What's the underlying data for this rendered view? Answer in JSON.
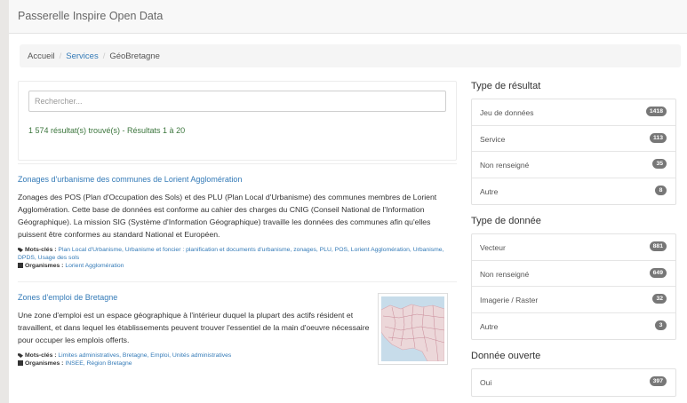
{
  "header": {
    "brand": "Passerelle Inspire Open Data"
  },
  "breadcrumb": {
    "home": "Accueil",
    "services": "Services",
    "current": "GéoBretagne"
  },
  "search": {
    "placeholder": "Rechercher...",
    "value": "",
    "count_text": "1 574 résultat(s) trouvé(s) - Résultats 1 à 20"
  },
  "results": [
    {
      "title": "Zonages d'urbanisme des communes de Lorient Agglomération",
      "description": "Zonages des POS (Plan d'Occupation des Sols) et des PLU (Plan Local d'Urbanisme) des communes membres de Lorient Agglomération. Cette base de données est conforme au cahier des charges du CNIG (Conseil National de l'Information Géographique). La mission SIG (Système d'Information Géographique) travaille les données des communes afin qu'elles puissent être conformes au standard National et Européen.",
      "keywords_label": "Mots-clés :",
      "keywords": "Plan Local d'Urbanisme, Urbanisme et foncier : planification et documents d'urbanisme, zonages, PLU, POS, Lorient Agglomération, Urbanisme, DPDS, Usage des sols",
      "orgs_label": "Organismes :",
      "orgs": "Lorient Agglomération"
    },
    {
      "title": "Zones d'emploi de Bretagne",
      "description": "Une zone d'emploi est un espace géographique à l'intérieur duquel la plupart des actifs résident et travaillent, et dans lequel les établissements peuvent trouver l'essentiel de la main d'oeuvre nécessaire pour occuper les emplois offerts.",
      "keywords_label": "Mots-clés :",
      "keywords": "Limites administratives, Bretagne, Emploi, Unités administratives",
      "orgs_label": "Organismes :",
      "orgs": "INSEE, Région Bretagne"
    }
  ],
  "facets": [
    {
      "title": "Type de résultat",
      "items": [
        {
          "label": "Jeu de données",
          "count": "1418"
        },
        {
          "label": "Service",
          "count": "113"
        },
        {
          "label": "Non renseigné",
          "count": "35"
        },
        {
          "label": "Autre",
          "count": "8"
        }
      ]
    },
    {
      "title": "Type de donnée",
      "items": [
        {
          "label": "Vecteur",
          "count": "881"
        },
        {
          "label": "Non renseigné",
          "count": "649"
        },
        {
          "label": "Imagerie / Raster",
          "count": "32"
        },
        {
          "label": "Autre",
          "count": "3"
        }
      ]
    },
    {
      "title": "Donnée ouverte",
      "items": [
        {
          "label": "Oui",
          "count": "397"
        }
      ]
    }
  ]
}
